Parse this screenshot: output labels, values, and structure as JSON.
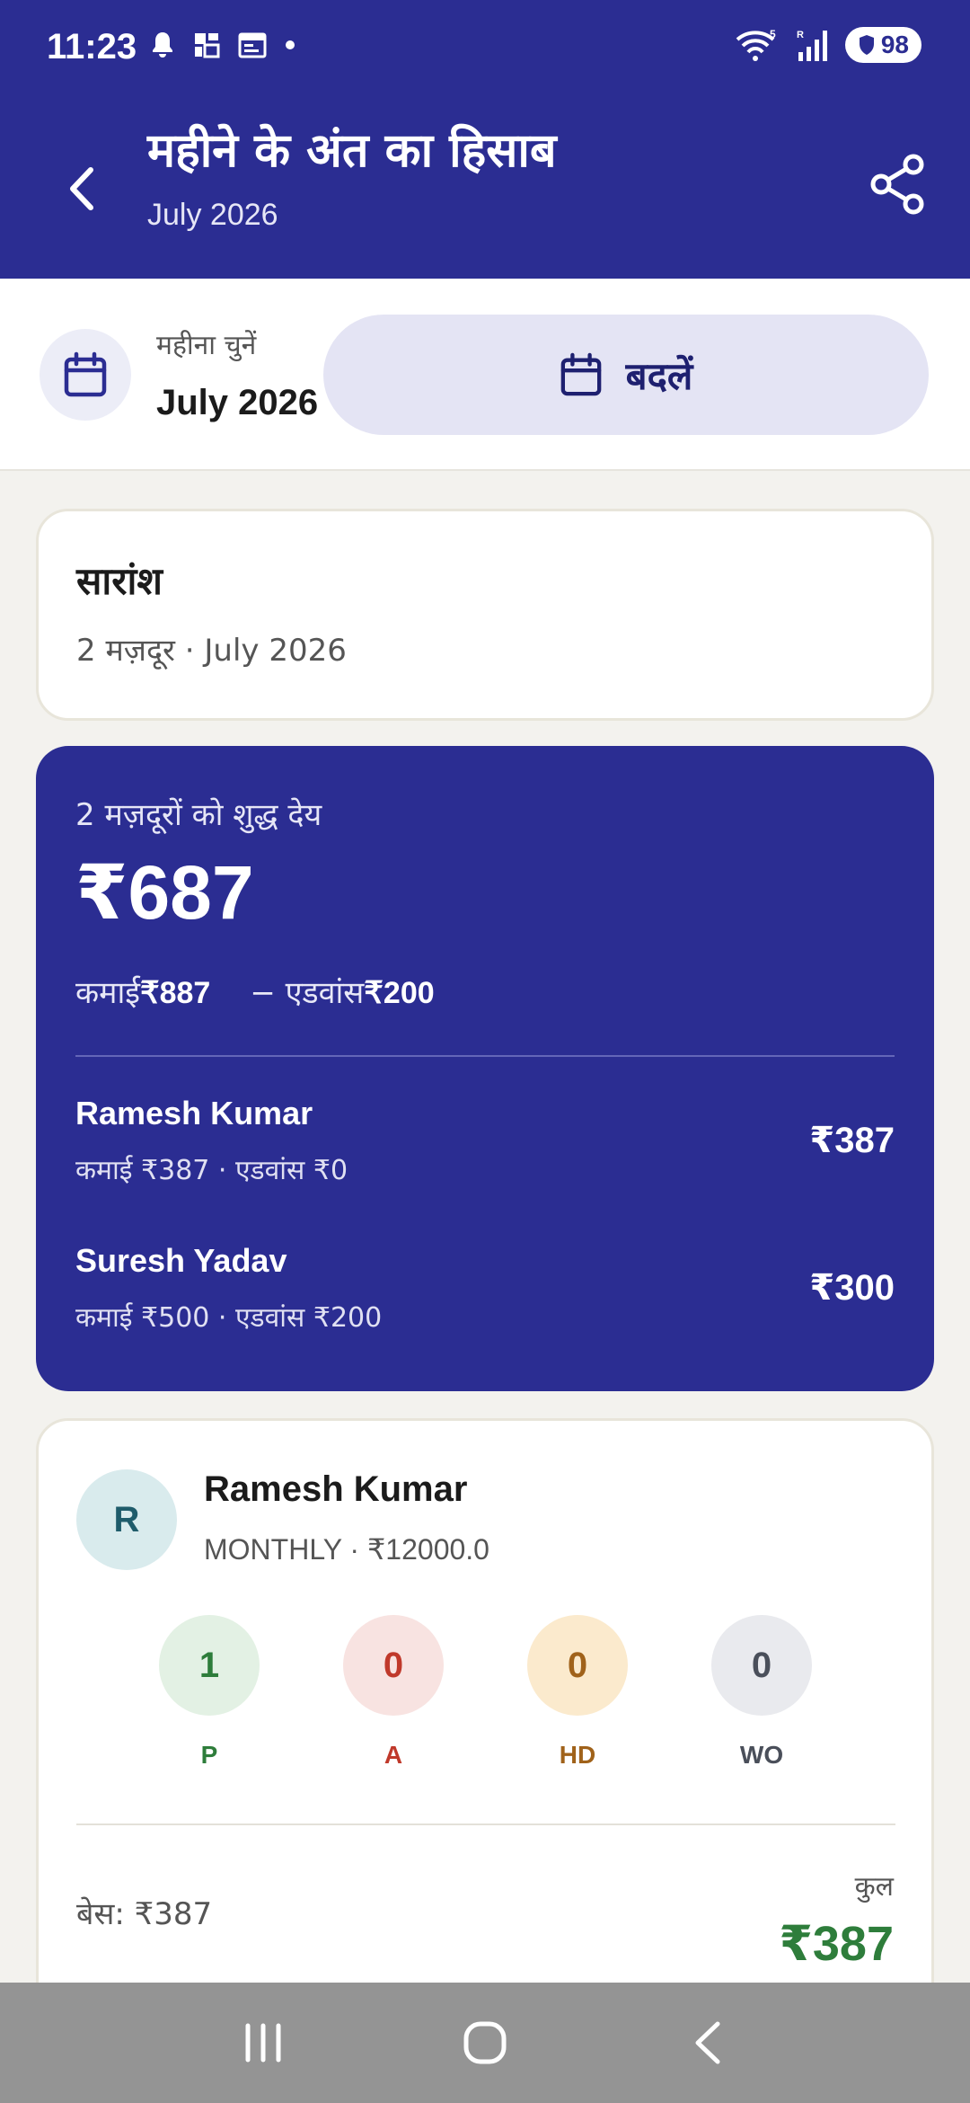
{
  "status_bar": {
    "time": "11:23",
    "battery": "98",
    "icons_left": [
      "bell-icon",
      "sim-icon",
      "calendar-icon",
      "dot-icon"
    ],
    "icons_right": [
      "wifi-icon",
      "signal-icon",
      "battery-icon"
    ]
  },
  "header": {
    "title": "महीने के अंत का हिसाब",
    "subtitle": "July 2026"
  },
  "month_picker": {
    "label": "महीना चुनें",
    "value": "July 2026",
    "change_label": "बदलें"
  },
  "summary": {
    "title": "सारांश",
    "subtitle": "2 मज़दूर · July 2026"
  },
  "net_payable": {
    "label": "2 मज़दूरों को शुद्ध देय",
    "amount": "₹687",
    "earnings_label": "कमाई",
    "earnings_value": "₹887",
    "advance_label": "− एडवांस",
    "advance_value": "₹200",
    "workers": [
      {
        "name": "Ramesh Kumar",
        "detail": "कमाई ₹387 · एडवांस ₹0",
        "net": "₹387"
      },
      {
        "name": "Suresh Yadav",
        "detail": "कमाई ₹500 · एडवांस ₹200",
        "net": "₹300"
      }
    ]
  },
  "worker_card": {
    "initial": "R",
    "name": "Ramesh Kumar",
    "plan": "MONTHLY · ₹12000.0",
    "attendance": [
      {
        "count": "1",
        "label": "P"
      },
      {
        "count": "0",
        "label": "A"
      },
      {
        "count": "0",
        "label": "HD"
      },
      {
        "count": "0",
        "label": "WO"
      }
    ],
    "base": "बेस: ₹387",
    "total_label": "कुल",
    "total": "₹387"
  },
  "colors": {
    "primary": "#2b2d92",
    "present": "#2e7d3b",
    "absent": "#c0392b",
    "half_day": "#a0621a",
    "week_off": "#4a4f5a"
  }
}
